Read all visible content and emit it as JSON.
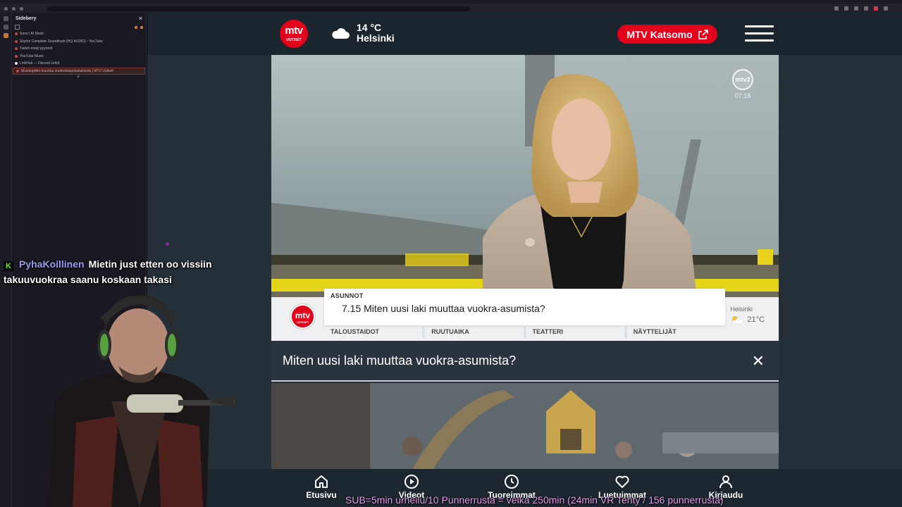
{
  "sidebery": {
    "title": "Sidebery",
    "close": "×",
    "new_tab": "+",
    "tabs": [
      {
        "label": "Suno | AI Music"
      },
      {
        "label": "Skyrim Complete Soundtrack (HQ AUDIO) - YouTube"
      },
      {
        "label": "Twitch emoji pyynnöt"
      },
      {
        "label": "YouTube Music"
      },
      {
        "label": "LinkHub — Discord Linkit"
      },
      {
        "label": "Muistiopiliini muuttuu vuokralaispelastuksista | MTV Uutiset"
      }
    ]
  },
  "chat": {
    "badge": "K",
    "username": "PyhaKoillinen",
    "message": "Mietin just etten oo vissiin takuuvuokraa saanu koskaan takasi"
  },
  "mtv": {
    "logo_main": "mtv",
    "logo_sub": "UUTISET",
    "weather_temp": "14 °C",
    "weather_city": "Helsinki",
    "katsomo_label": "MTV Katsomo",
    "video": {
      "bug_label": "mtv3",
      "bug_time": "07:18",
      "lower_third": {
        "category": "ASUNNOT",
        "headline": "7.15 Miten uusi laki muuttaa vuokra-asumista?",
        "topics": [
          "TALOUSTAIDOT",
          "RUUTUAIKA",
          "TEATTERI",
          "NÄYTTELIJÄT"
        ],
        "weather_city": "Helsinki",
        "weather_temp": "21°C",
        "logo_main": "mtv",
        "logo_sub": "UUTISET"
      }
    },
    "caption": "Miten uusi laki muuttaa vuokra-asumista?",
    "caption_close": "✕",
    "nav": [
      {
        "label": "Etusivu",
        "icon": "home-icon"
      },
      {
        "label": "Videot",
        "icon": "play-icon"
      },
      {
        "label": "Tuoreimmat",
        "icon": "clock-icon"
      },
      {
        "label": "Luetuimmat",
        "icon": "heart-icon"
      },
      {
        "label": "Kirjaudu",
        "icon": "user-icon"
      }
    ]
  },
  "ticker": "SUB=5min urheilu/10 Punnerrusta = velka 250min (24min VR Tehty / 156 punnerrusta)",
  "colors": {
    "mtv_red": "#e2001a",
    "page_bg": "#252f38",
    "header_bg": "#1a252e",
    "chat_username": "#9c9cf6",
    "ticker": "#e59ee8"
  }
}
